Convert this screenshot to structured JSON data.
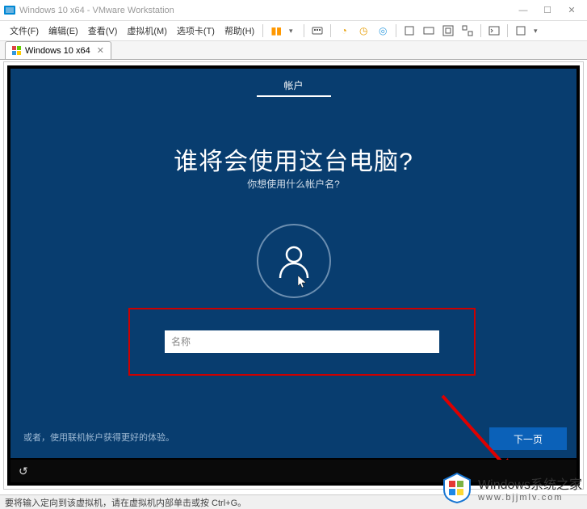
{
  "titlebar": {
    "app_title": "Windows 10 x64 - VMware Workstation",
    "min": "—",
    "max": "☐",
    "close": "✕"
  },
  "menubar": {
    "items": [
      {
        "label": "文件(F)"
      },
      {
        "label": "编辑(E)"
      },
      {
        "label": "查看(V)"
      },
      {
        "label": "虚拟机(M)"
      },
      {
        "label": "选项卡(T)"
      },
      {
        "label": "帮助(H)"
      }
    ]
  },
  "tab": {
    "label": "Windows 10 x64"
  },
  "oobe": {
    "tab_label": "帐户",
    "heading": "谁将会使用这台电脑?",
    "subheading": "你想使用什么帐户名?",
    "input_placeholder": "名称",
    "input_value": "",
    "offline_text": "或者，使用联机帐户获得更好的体验。",
    "next_label": "下一页"
  },
  "statusbar": {
    "text": "要将输入定向到该虚拟机，请在虚拟机内部单击或按 Ctrl+G。"
  },
  "watermark": {
    "line1": "Windows系统之家",
    "line2": "www.bjjmlv.com"
  }
}
